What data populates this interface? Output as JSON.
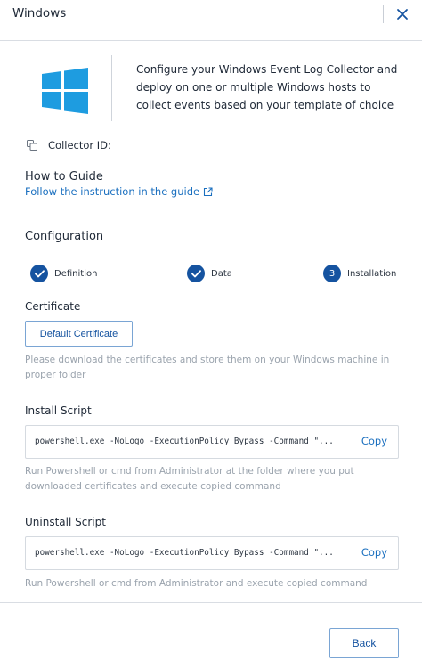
{
  "header": {
    "title": "Windows",
    "close_icon": "close-icon"
  },
  "intro": {
    "logo_icon": "windows-logo",
    "description": "Configure your Windows Event Log Collector and deploy on one or multiple Windows hosts to collect events based on your template of choice"
  },
  "collector": {
    "label": "Collector ID:",
    "icon": "copy-icon"
  },
  "how_to": {
    "title": "How to Guide",
    "link_text": "Follow the instruction in the guide",
    "link_icon": "external-link-icon"
  },
  "configuration": {
    "title": "Configuration",
    "steps": [
      {
        "label": "Definition",
        "status": "complete"
      },
      {
        "label": "Data",
        "status": "complete"
      },
      {
        "label": "Installation",
        "number": "3",
        "status": "current"
      }
    ]
  },
  "certificate": {
    "title": "Certificate",
    "button_label": "Default Certificate",
    "hint": "Please download the certificates and store them on your Windows machine in proper folder"
  },
  "install": {
    "title": "Install Script",
    "script": "powershell.exe -NoLogo -ExecutionPolicy Bypass -Command \"...",
    "copy_label": "Copy",
    "hint": "Run Powershell or cmd from Administrator at the folder where you put downloaded certificates and execute copied command"
  },
  "uninstall": {
    "title": "Uninstall Script",
    "script": "powershell.exe -NoLogo -ExecutionPolicy Bypass -Command \"...",
    "copy_label": "Copy",
    "hint": "Run Powershell or cmd from Administrator and execute copied command"
  },
  "footer": {
    "back_label": "Back"
  },
  "colors": {
    "accent": "#1553a0",
    "link": "#1a6fbf",
    "logo": "#1e9ce0",
    "muted_text": "#9aa3ad"
  }
}
